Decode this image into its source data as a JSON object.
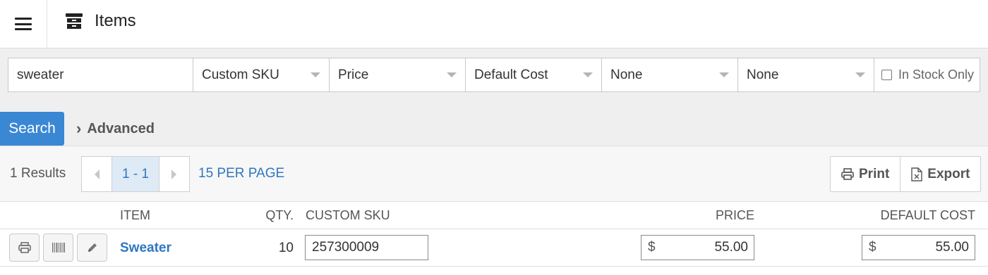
{
  "header": {
    "title": "Items",
    "menu_icon": "hamburger-icon",
    "title_icon": "archive-box-icon"
  },
  "filters": {
    "search_value": "sweater",
    "selects": [
      "Custom SKU",
      "Price",
      "Default Cost",
      "None",
      "None"
    ],
    "in_stock_label": "In Stock Only",
    "in_stock_checked": false
  },
  "search_button": "Search",
  "advanced_label": "Advanced",
  "results": {
    "count_label": "1 Results",
    "page_range": "1 - 1",
    "per_page": "15 PER PAGE",
    "print_label": "Print",
    "export_label": "Export"
  },
  "table": {
    "columns": {
      "item": "ITEM",
      "qty": "QTY.",
      "custom_sku": "CUSTOM SKU",
      "price": "PRICE",
      "default_cost": "DEFAULT COST"
    },
    "rows": [
      {
        "item": "Sweater",
        "qty": "10",
        "custom_sku": "257300009",
        "price_currency": "$",
        "price": "55.00",
        "cost_currency": "$",
        "default_cost": "55.00"
      }
    ]
  },
  "colors": {
    "accent": "#3a87d4",
    "link": "#2f76c0",
    "filter_bg": "#efefef"
  }
}
